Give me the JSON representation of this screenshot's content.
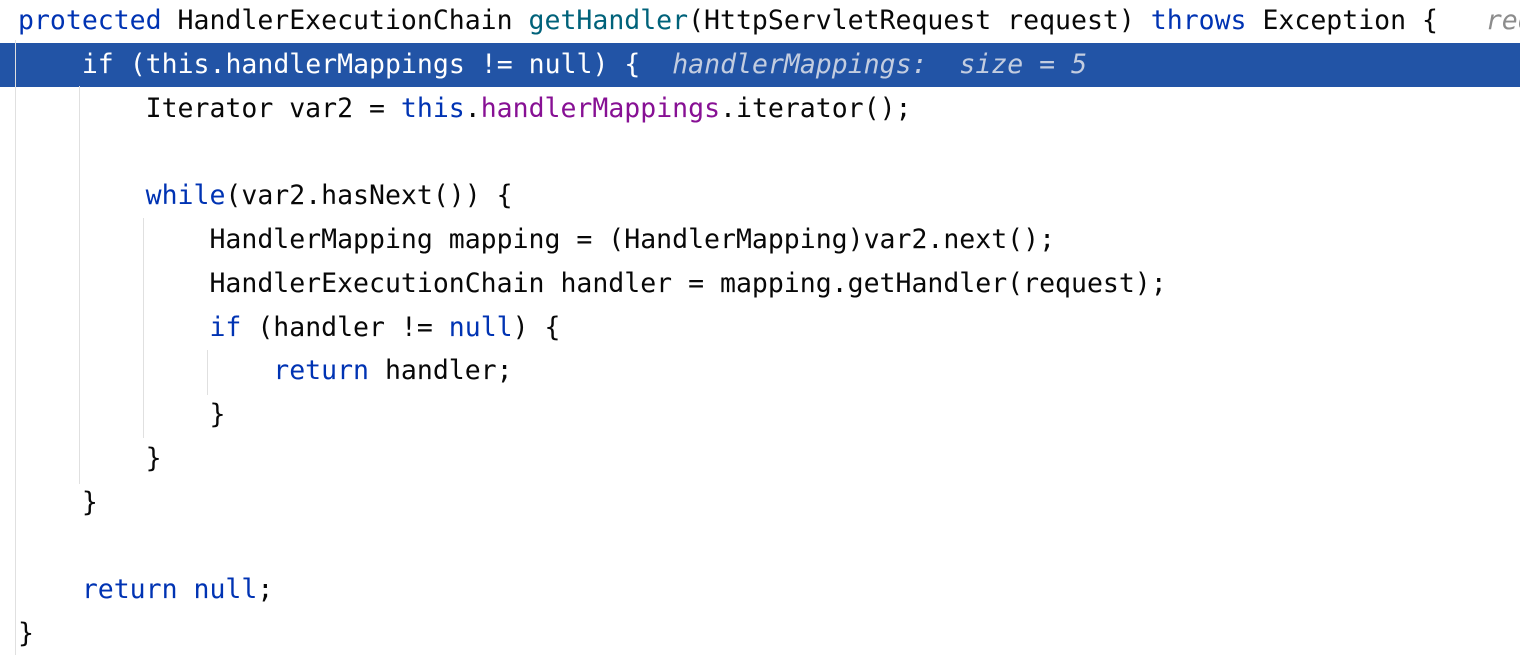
{
  "editor": {
    "current_line_index": 1,
    "colors": {
      "keyword": "#0033b3",
      "method": "#00627a",
      "field": "#871094",
      "hint": "#8c8c8c",
      "current_line": "#2254a6"
    },
    "lines": [
      {
        "tokens": [
          {
            "t": "protected",
            "c": "kw"
          },
          {
            "t": " HandlerExecutionChain ",
            "c": "plain"
          },
          {
            "t": "getHandler",
            "c": "fn"
          },
          {
            "t": "(HttpServletRequest request) ",
            "c": "plain"
          },
          {
            "t": "throws",
            "c": "kw"
          },
          {
            "t": " Exception {",
            "c": "plain"
          },
          {
            "t": "   req",
            "c": "hint"
          }
        ]
      },
      {
        "tokens": [
          {
            "t": "    if",
            "c": "kw"
          },
          {
            "t": " (",
            "c": "plain"
          },
          {
            "t": "this",
            "c": "kw"
          },
          {
            "t": ".",
            "c": "plain"
          },
          {
            "t": "handlerMappings",
            "c": "field"
          },
          {
            "t": " != ",
            "c": "plain"
          },
          {
            "t": "null",
            "c": "kw"
          },
          {
            "t": ") {",
            "c": "plain"
          },
          {
            "t": "  handlerMappings:  size = 5",
            "c": "hint"
          }
        ]
      },
      {
        "tokens": [
          {
            "t": "        Iterator var2 = ",
            "c": "plain"
          },
          {
            "t": "this",
            "c": "kw"
          },
          {
            "t": ".",
            "c": "plain"
          },
          {
            "t": "handlerMappings",
            "c": "field"
          },
          {
            "t": ".iterator();",
            "c": "plain"
          }
        ]
      },
      {
        "tokens": []
      },
      {
        "tokens": [
          {
            "t": "        while",
            "c": "kw"
          },
          {
            "t": "(var2.hasNext()) {",
            "c": "plain"
          }
        ]
      },
      {
        "tokens": [
          {
            "t": "            HandlerMapping mapping = (HandlerMapping)var2.next();",
            "c": "plain"
          }
        ]
      },
      {
        "tokens": [
          {
            "t": "            HandlerExecutionChain handler = mapping.getHandler(request);",
            "c": "plain"
          }
        ]
      },
      {
        "tokens": [
          {
            "t": "            if",
            "c": "kw"
          },
          {
            "t": " (handler != ",
            "c": "plain"
          },
          {
            "t": "null",
            "c": "kw"
          },
          {
            "t": ") {",
            "c": "plain"
          }
        ]
      },
      {
        "tokens": [
          {
            "t": "                return",
            "c": "kw"
          },
          {
            "t": " handler;",
            "c": "plain"
          }
        ]
      },
      {
        "tokens": [
          {
            "t": "            }",
            "c": "plain"
          }
        ]
      },
      {
        "tokens": [
          {
            "t": "        }",
            "c": "plain"
          }
        ]
      },
      {
        "tokens": [
          {
            "t": "    }",
            "c": "plain"
          }
        ]
      },
      {
        "tokens": []
      },
      {
        "tokens": [
          {
            "t": "    return",
            "c": "kw"
          },
          {
            "t": " ",
            "c": "plain"
          },
          {
            "t": "null",
            "c": "kw"
          },
          {
            "t": ";",
            "c": "plain"
          }
        ]
      },
      {
        "tokens": [
          {
            "t": "}",
            "c": "plain"
          }
        ]
      }
    ]
  }
}
